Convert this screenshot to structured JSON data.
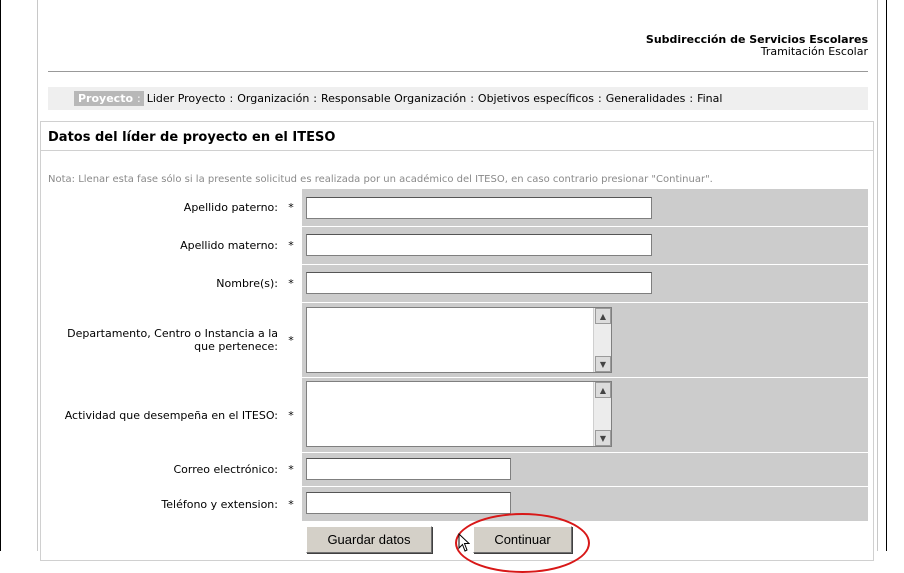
{
  "header": {
    "title": "Subdirección de Servicios Escolares",
    "subtitle": "Tramitación Escolar"
  },
  "steps": {
    "active": "Proyecto",
    "items": [
      "Lider Proyecto",
      "Organización",
      "Responsable Organización",
      "Objetivos específicos",
      "Generalidades",
      "Final"
    ],
    "separator": ":"
  },
  "section": {
    "title": "Datos del líder de proyecto en el ITESO",
    "note": "Nota: Llenar esta fase sólo si la presente solicitud es realizada por un académico del ITESO, en caso contrario presionar \"Continuar\"."
  },
  "form": {
    "required_mark": "*",
    "fields": [
      {
        "label": "Apellido paterno:",
        "value": ""
      },
      {
        "label": "Apellido materno:",
        "value": ""
      },
      {
        "label": "Nombre(s):",
        "value": ""
      },
      {
        "label": "Departamento, Centro o Instancia a la que pertenece:",
        "value": ""
      },
      {
        "label": "Actividad que desempeña en el ITESO:",
        "value": ""
      },
      {
        "label": "Correo electrónico:",
        "value": ""
      },
      {
        "label": "Teléfono y extension:",
        "value": ""
      }
    ]
  },
  "buttons": {
    "save": "Guardar datos",
    "continue": "Continuar"
  },
  "colors": {
    "field_bg": "#cccccc",
    "active_step_bg": "#b8b8b8",
    "highlight_ring": "#d81818"
  },
  "icons": {
    "scroll_up": "scroll-up-arrow-icon",
    "scroll_down": "scroll-down-arrow-icon",
    "cursor": "mouse-pointer-icon"
  }
}
